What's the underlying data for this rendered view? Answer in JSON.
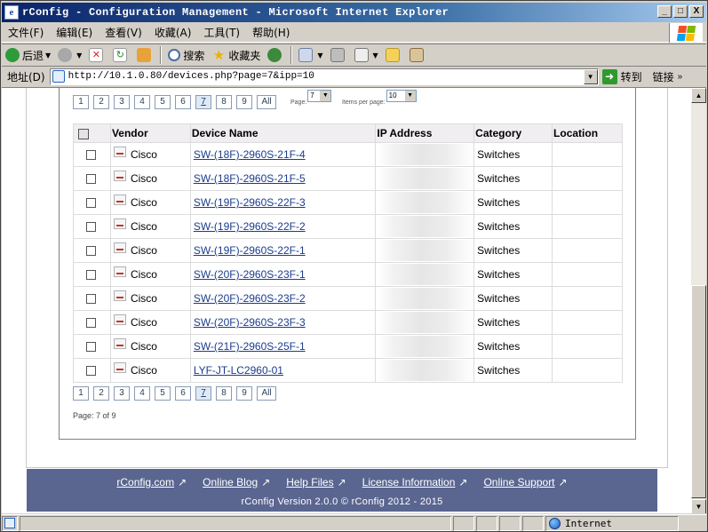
{
  "window": {
    "title": "rConfig - Configuration Management - Microsoft Internet Explorer",
    "controls": [
      "_",
      "□",
      "X"
    ]
  },
  "menu": [
    "文件(F)",
    "编辑(E)",
    "查看(V)",
    "收藏(A)",
    "工具(T)",
    "帮助(H)"
  ],
  "toolbar": {
    "back": "后退",
    "search": "搜索",
    "favorites": "收藏夹"
  },
  "address": {
    "label": "地址(D)",
    "url": "http://10.1.0.80/devices.php?page=7&ipp=10",
    "go": "转到",
    "links": "链接"
  },
  "pager": {
    "pages": [
      "1",
      "2",
      "3",
      "4",
      "5",
      "6",
      "7",
      "8",
      "9"
    ],
    "current": "7",
    "all_label": "All",
    "page_label": "Page:",
    "page_select": "7",
    "ipp_label": "Items per page:",
    "ipp_select": "10",
    "page_count": "Page: 7 of 9"
  },
  "table": {
    "headers": {
      "vendor": "Vendor",
      "device_name": "Device Name",
      "ip_address": "IP Address",
      "category": "Category",
      "location": "Location"
    },
    "rows": [
      {
        "vendor": "Cisco",
        "name": "SW-(18F)-2960S-21F-4",
        "category": "Switches",
        "location": ""
      },
      {
        "vendor": "Cisco",
        "name": "SW-(18F)-2960S-21F-5",
        "category": "Switches",
        "location": ""
      },
      {
        "vendor": "Cisco",
        "name": "SW-(19F)-2960S-22F-3",
        "category": "Switches",
        "location": ""
      },
      {
        "vendor": "Cisco",
        "name": "SW-(19F)-2960S-22F-2",
        "category": "Switches",
        "location": ""
      },
      {
        "vendor": "Cisco",
        "name": "SW-(19F)-2960S-22F-1",
        "category": "Switches",
        "location": ""
      },
      {
        "vendor": "Cisco",
        "name": "SW-(20F)-2960S-23F-1",
        "category": "Switches",
        "location": ""
      },
      {
        "vendor": "Cisco",
        "name": "SW-(20F)-2960S-23F-2",
        "category": "Switches",
        "location": ""
      },
      {
        "vendor": "Cisco",
        "name": "SW-(20F)-2960S-23F-3",
        "category": "Switches",
        "location": ""
      },
      {
        "vendor": "Cisco",
        "name": "SW-(21F)-2960S-25F-1",
        "category": "Switches",
        "location": ""
      },
      {
        "vendor": "Cisco",
        "name": "LYF-JT-LC2960-01",
        "category": "Switches",
        "location": ""
      }
    ]
  },
  "footer": {
    "links": [
      "rConfig.com",
      "Online Blog",
      "Help Files",
      "License Information",
      "Online Support"
    ],
    "version": "rConfig Version 2.0.0  © rConfig 2012 - 2015"
  },
  "status": {
    "zone": "Internet"
  },
  "colors": {
    "footer_bg": "#5a6690",
    "link": "#1a3c8c",
    "titlebar": "#0a246a"
  }
}
